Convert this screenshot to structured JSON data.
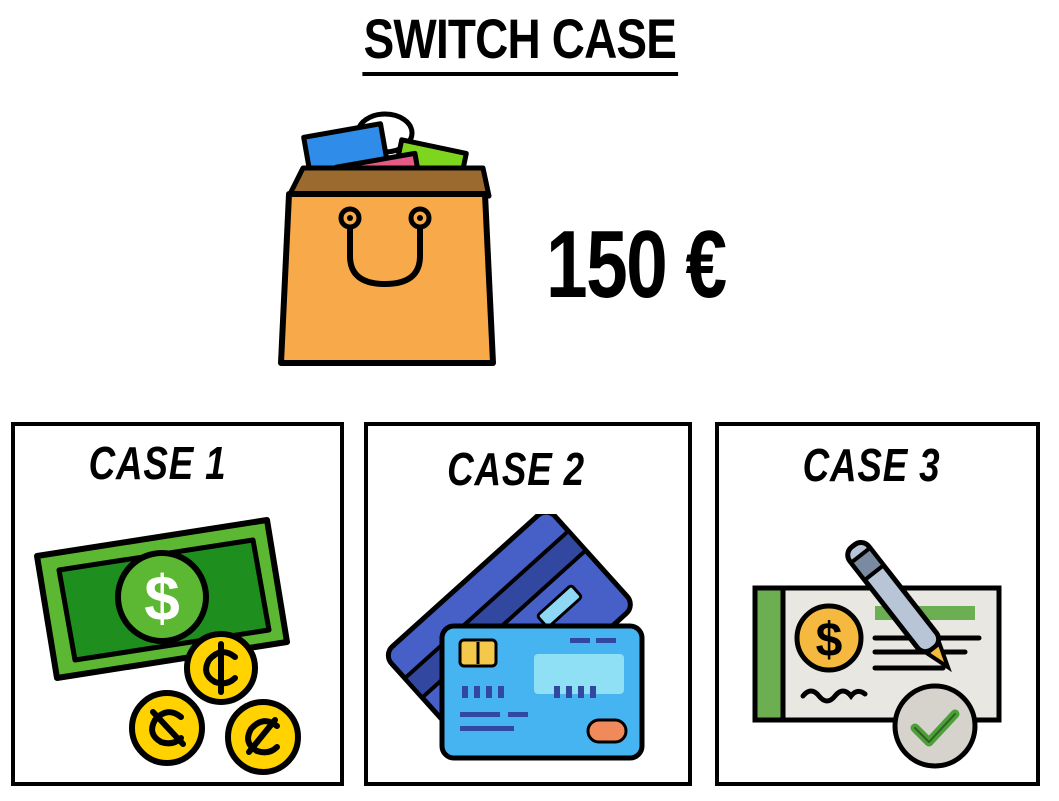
{
  "title": "SWITCH CASE",
  "price": "150 €",
  "cases": [
    {
      "label": "CASE  1",
      "icon": "cash-icon"
    },
    {
      "label": "CASE  2",
      "icon": "credit-cards-icon"
    },
    {
      "label": "CASE  3",
      "icon": "check-icon"
    }
  ],
  "colors": {
    "bag": "#F8AA4B",
    "bill": "#5CB832",
    "coin": "#FFD200",
    "card_front": "#46B4F0",
    "card_back": "#4660C8",
    "cheque": "#E9E7E2",
    "cheque_accent": "#6BAF52"
  }
}
